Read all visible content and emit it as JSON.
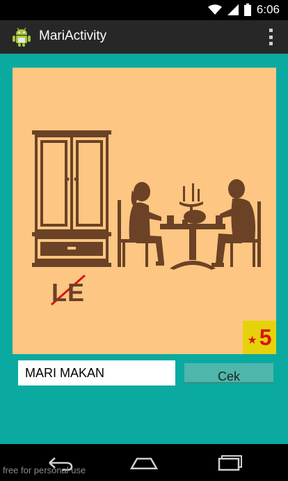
{
  "status_bar": {
    "time": "6:06",
    "icons": [
      "wifi-icon",
      "signal-icon",
      "battery-icon"
    ]
  },
  "action_bar": {
    "title": "MariActivity",
    "icon": "android-icon",
    "menu_icon": "overflow-menu-icon"
  },
  "puzzle": {
    "crossed_text": "LE",
    "score": "5",
    "score_icon": "star-icon"
  },
  "answer": {
    "value": "MARI MAKAN"
  },
  "check_button": {
    "label": "Cek"
  },
  "nav_bar": {
    "buttons": [
      "back-icon",
      "home-icon",
      "recent-apps-icon"
    ]
  },
  "watermark": "free for personal use",
  "colors": {
    "background": "#0aaaa0",
    "image_bg": "#fdc682",
    "silhouette": "#6b4226",
    "badge": "#e6d20a",
    "badge_text": "#d81414",
    "button": "#4fb6ac"
  }
}
